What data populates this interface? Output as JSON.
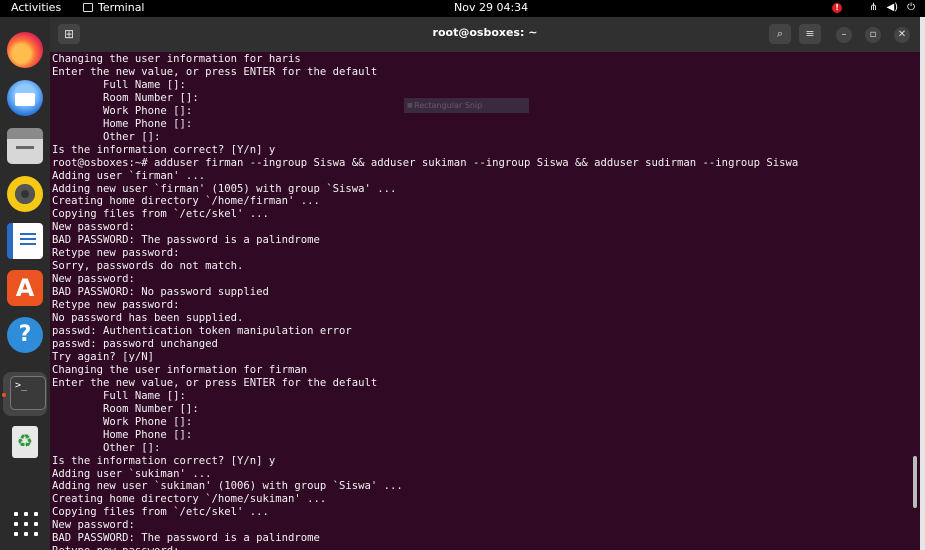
{
  "topbar": {
    "activities": "Activities",
    "app_name": "Terminal",
    "clock": "Nov 29  04:34",
    "alert_glyph": "!"
  },
  "dock": {
    "items": [
      "firefox",
      "thunderbird",
      "files",
      "rhythmbox",
      "libreoffice-writer",
      "app-center",
      "help",
      "terminal",
      "trash",
      "show-apps"
    ],
    "terminal_glyph": ">_",
    "trash_glyph": "♻"
  },
  "window": {
    "title": "root@osboxes: ~"
  },
  "tooltip": {
    "label": "Rectangular Snip"
  },
  "terminal": {
    "lines": [
      "Changing the user information for haris",
      "Enter the new value, or press ENTER for the default",
      "        Full Name []:",
      "        Room Number []:",
      "        Work Phone []:",
      "        Home Phone []:",
      "        Other []:",
      "Is the information correct? [Y/n] y",
      "root@osboxes:~# adduser firman --ingroup Siswa && adduser sukiman --ingroup Siswa && adduser sudirman --ingroup Siswa",
      "Adding user `firman' ...",
      "Adding new user `firman' (1005) with group `Siswa' ...",
      "Creating home directory `/home/firman' ...",
      "Copying files from `/etc/skel' ...",
      "New password:",
      "BAD PASSWORD: The password is a palindrome",
      "Retype new password:",
      "Sorry, passwords do not match.",
      "New password:",
      "BAD PASSWORD: No password supplied",
      "Retype new password:",
      "No password has been supplied.",
      "passwd: Authentication token manipulation error",
      "passwd: password unchanged",
      "Try again? [y/N]",
      "Changing the user information for firman",
      "Enter the new value, or press ENTER for the default",
      "        Full Name []:",
      "        Room Number []:",
      "        Work Phone []:",
      "        Home Phone []:",
      "        Other []:",
      "Is the information correct? [Y/n] y",
      "Adding user `sukiman' ...",
      "Adding new user `sukiman' (1006) with group `Siswa' ...",
      "Creating home directory `/home/sukiman' ...",
      "Copying files from `/etc/skel' ...",
      "New password:",
      "BAD PASSWORD: The password is a palindrome",
      "Retype new password:"
    ]
  }
}
